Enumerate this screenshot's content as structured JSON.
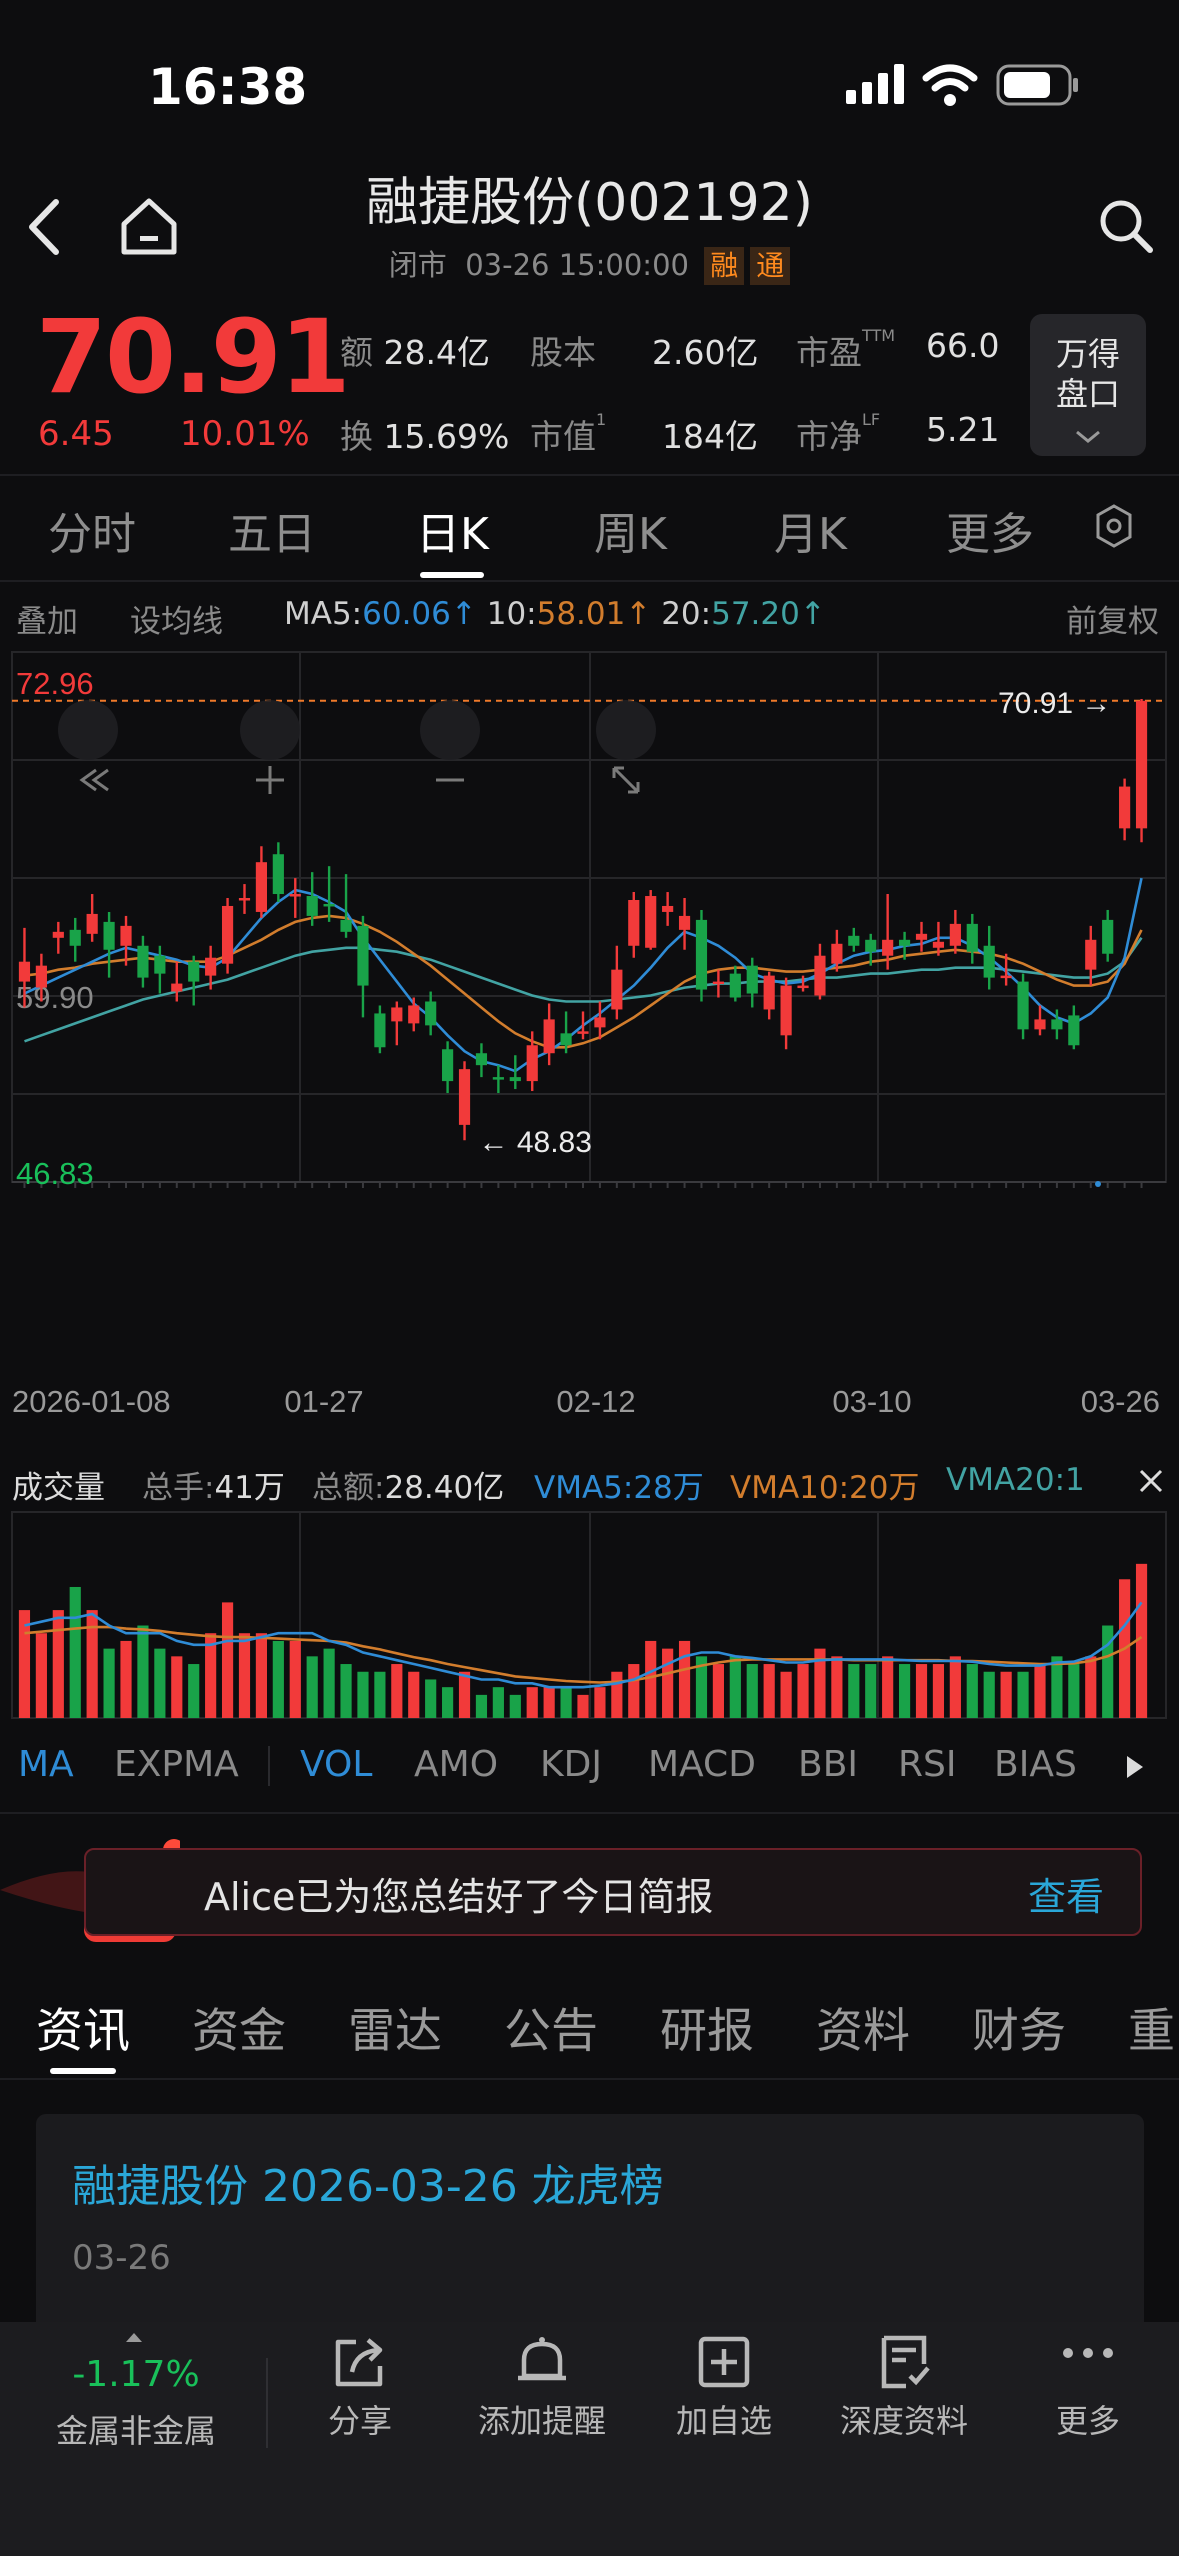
{
  "status": {
    "time": "16:38"
  },
  "header": {
    "title": "融捷股份(002192)",
    "status": "闭市",
    "datetime": "03-26 15:00:00",
    "tag1": "融",
    "tag2": "通"
  },
  "quote": {
    "price": "70.91",
    "change": "6.45",
    "change_pct": "10.01%",
    "amount_label": "额",
    "amount": "28.4亿",
    "capital_label": "股本",
    "capital": "2.60亿",
    "pe_label": "市盈",
    "pe_sup": "TTM",
    "pe": "66.0",
    "turnover_label": "换",
    "turnover": "15.69%",
    "mktcap_label": "市值",
    "mktcap_sup": "1",
    "mktcap": "184亿",
    "pb_label": "市净",
    "pb_sup": "LF",
    "pb": "5.21",
    "wande_line1": "万得",
    "wande_line2": "盘口"
  },
  "period_tabs": [
    "分时",
    "五日",
    "日K",
    "周K",
    "月K",
    "更多"
  ],
  "ma_bar": {
    "overlay": "叠加",
    "set_ma": "设均线",
    "ma5_label": "MA5:",
    "ma5": "60.06↑",
    "ma10_label": "10:",
    "ma10": "58.01↑",
    "ma20_label": "20:",
    "ma20": "57.20↑",
    "adjust": "前复权"
  },
  "chart_data": {
    "type": "candlestick",
    "y_labels": {
      "top": "72.96",
      "mid": "59.90",
      "bottom": "46.83"
    },
    "ylim": [
      46.83,
      72.96
    ],
    "x_labels": [
      "2026-01-08",
      "01-27",
      "02-12",
      "03-10",
      "03-26"
    ],
    "last_price_label": "70.91",
    "low_label": "48.83",
    "candles": [
      {
        "o": 56.8,
        "c": 57.8,
        "h": 59.5,
        "l": 55.5
      },
      {
        "o": 56.5,
        "c": 57.6,
        "h": 58.2,
        "l": 55.8
      },
      {
        "o": 59.0,
        "c": 59.3,
        "h": 59.8,
        "l": 58.2
      },
      {
        "o": 59.4,
        "c": 58.6,
        "h": 60.0,
        "l": 57.8
      },
      {
        "o": 59.2,
        "c": 60.2,
        "h": 61.2,
        "l": 58.8
      },
      {
        "o": 59.8,
        "c": 58.4,
        "h": 60.3,
        "l": 57.0
      },
      {
        "o": 58.6,
        "c": 59.6,
        "h": 60.1,
        "l": 57.6
      },
      {
        "o": 58.6,
        "c": 57.0,
        "h": 59.1,
        "l": 56.5
      },
      {
        "o": 58.1,
        "c": 57.2,
        "h": 58.6,
        "l": 56.2
      },
      {
        "o": 56.3,
        "c": 56.7,
        "h": 57.8,
        "l": 55.8
      },
      {
        "o": 57.8,
        "c": 56.8,
        "h": 58.1,
        "l": 55.6
      },
      {
        "o": 57.1,
        "c": 58.0,
        "h": 58.6,
        "l": 56.4
      },
      {
        "o": 57.7,
        "c": 60.6,
        "h": 61.0,
        "l": 57.2
      },
      {
        "o": 61.0,
        "c": 61.0,
        "h": 61.7,
        "l": 60.2
      },
      {
        "o": 60.3,
        "c": 62.8,
        "h": 63.6,
        "l": 60.0
      },
      {
        "o": 63.2,
        "c": 61.2,
        "h": 63.8,
        "l": 60.8
      },
      {
        "o": 61.1,
        "c": 61.2,
        "h": 62.0,
        "l": 60.0
      },
      {
        "o": 61.1,
        "c": 60.1,
        "h": 62.3,
        "l": 59.6
      },
      {
        "o": 60.7,
        "c": 60.6,
        "h": 62.6,
        "l": 59.8
      },
      {
        "o": 59.9,
        "c": 59.3,
        "h": 62.2,
        "l": 59.0
      },
      {
        "o": 59.6,
        "c": 56.6,
        "h": 60.1,
        "l": 55.0
      },
      {
        "o": 55.2,
        "c": 53.5,
        "h": 55.6,
        "l": 53.2
      },
      {
        "o": 54.8,
        "c": 55.5,
        "h": 55.8,
        "l": 53.6
      },
      {
        "o": 54.7,
        "c": 55.6,
        "h": 56.0,
        "l": 54.3
      },
      {
        "o": 55.8,
        "c": 54.6,
        "h": 56.3,
        "l": 54.1
      },
      {
        "o": 53.4,
        "c": 51.8,
        "h": 53.8,
        "l": 51.2
      },
      {
        "o": 49.6,
        "c": 52.4,
        "h": 52.8,
        "l": 48.83
      },
      {
        "o": 53.2,
        "c": 52.6,
        "h": 53.7,
        "l": 52.0
      },
      {
        "o": 52.0,
        "c": 51.9,
        "h": 52.6,
        "l": 51.2
      },
      {
        "o": 52.0,
        "c": 51.8,
        "h": 53.1,
        "l": 51.4
      },
      {
        "o": 51.8,
        "c": 53.6,
        "h": 54.3,
        "l": 51.3
      },
      {
        "o": 53.2,
        "c": 54.9,
        "h": 55.7,
        "l": 52.6
      },
      {
        "o": 54.2,
        "c": 53.6,
        "h": 55.3,
        "l": 53.2
      },
      {
        "o": 54.2,
        "c": 54.3,
        "h": 55.3,
        "l": 53.9
      },
      {
        "o": 54.5,
        "c": 55.0,
        "h": 55.8,
        "l": 53.9
      },
      {
        "o": 55.4,
        "c": 57.4,
        "h": 58.6,
        "l": 54.9
      },
      {
        "o": 58.6,
        "c": 60.9,
        "h": 61.3,
        "l": 58.0
      },
      {
        "o": 58.5,
        "c": 61.1,
        "h": 61.4,
        "l": 58.4
      },
      {
        "o": 60.3,
        "c": 60.6,
        "h": 61.3,
        "l": 59.6
      },
      {
        "o": 59.4,
        "c": 60.1,
        "h": 61.0,
        "l": 58.4
      },
      {
        "o": 59.9,
        "c": 56.4,
        "h": 60.4,
        "l": 55.8
      },
      {
        "o": 56.8,
        "c": 56.8,
        "h": 57.4,
        "l": 56.0
      },
      {
        "o": 57.2,
        "c": 56.0,
        "h": 57.6,
        "l": 55.8
      },
      {
        "o": 57.6,
        "c": 56.2,
        "h": 58.0,
        "l": 55.5
      },
      {
        "o": 55.4,
        "c": 57.1,
        "h": 57.3,
        "l": 54.9
      },
      {
        "o": 54.1,
        "c": 56.6,
        "h": 57.0,
        "l": 53.4
      },
      {
        "o": 56.6,
        "c": 56.6,
        "h": 57.1,
        "l": 56.3
      },
      {
        "o": 56.1,
        "c": 58.1,
        "h": 58.7,
        "l": 55.9
      },
      {
        "o": 57.7,
        "c": 58.7,
        "h": 59.4,
        "l": 57.3
      },
      {
        "o": 59.1,
        "c": 58.6,
        "h": 59.5,
        "l": 58.3
      },
      {
        "o": 58.9,
        "c": 58.3,
        "h": 59.2,
        "l": 57.6
      },
      {
        "o": 58.1,
        "c": 58.9,
        "h": 61.2,
        "l": 57.4
      },
      {
        "o": 58.9,
        "c": 58.6,
        "h": 59.3,
        "l": 57.9
      },
      {
        "o": 58.9,
        "c": 59.2,
        "h": 59.8,
        "l": 58.3
      },
      {
        "o": 58.5,
        "c": 58.8,
        "h": 59.8,
        "l": 58.1
      },
      {
        "o": 58.6,
        "c": 59.7,
        "h": 60.4,
        "l": 58.2
      },
      {
        "o": 59.7,
        "c": 58.3,
        "h": 60.2,
        "l": 57.7
      },
      {
        "o": 58.6,
        "c": 57.0,
        "h": 59.6,
        "l": 56.4
      },
      {
        "o": 57.0,
        "c": 57.1,
        "h": 58.2,
        "l": 56.6
      },
      {
        "o": 56.8,
        "c": 54.4,
        "h": 57.2,
        "l": 53.9
      },
      {
        "o": 54.4,
        "c": 54.9,
        "h": 55.6,
        "l": 54.1
      },
      {
        "o": 54.9,
        "c": 54.4,
        "h": 55.4,
        "l": 53.9
      },
      {
        "o": 55.1,
        "c": 53.6,
        "h": 55.6,
        "l": 53.4
      },
      {
        "o": 57.4,
        "c": 58.9,
        "h": 59.6,
        "l": 56.6
      },
      {
        "o": 59.9,
        "c": 58.2,
        "h": 60.4,
        "l": 57.8
      },
      {
        "o": 64.5,
        "c": 66.6,
        "h": 67.0,
        "l": 63.9
      },
      {
        "o": 64.5,
        "c": 70.91,
        "h": 71.0,
        "l": 63.8
      }
    ],
    "ma5": [
      56.2,
      56.6,
      57.0,
      57.4,
      57.8,
      58.2,
      58.5,
      58.3,
      58.1,
      57.9,
      57.6,
      57.5,
      58.0,
      59.0,
      60.0,
      60.8,
      61.4,
      61.2,
      60.8,
      60.3,
      59.0,
      57.9,
      56.8,
      55.7,
      55.0,
      54.1,
      53.3,
      52.8,
      52.6,
      52.3,
      52.9,
      53.3,
      53.9,
      54.6,
      55.2,
      55.9,
      56.6,
      57.5,
      58.5,
      59.3,
      59.0,
      58.6,
      58.0,
      57.2,
      56.9,
      56.7,
      56.8,
      57.2,
      57.7,
      58.1,
      58.3,
      58.4,
      58.6,
      58.7,
      59.0,
      59.0,
      58.6,
      58.0,
      57.3,
      56.5,
      55.6,
      55.0,
      54.7,
      55.2,
      56.0,
      58.0,
      62.0
    ],
    "ma10": [
      57.1,
      57.2,
      57.4,
      57.5,
      57.7,
      57.8,
      57.9,
      58.0,
      57.9,
      57.8,
      57.8,
      57.8,
      58.1,
      58.5,
      58.9,
      59.4,
      59.8,
      60.0,
      60.1,
      60.0,
      59.7,
      59.3,
      58.8,
      58.2,
      57.6,
      56.9,
      56.2,
      55.5,
      54.8,
      54.2,
      53.8,
      53.5,
      53.5,
      53.7,
      54.0,
      54.5,
      55.0,
      55.6,
      56.2,
      56.8,
      57.2,
      57.4,
      57.5,
      57.5,
      57.4,
      57.3,
      57.3,
      57.4,
      57.5,
      57.6,
      57.8,
      57.9,
      58.1,
      58.2,
      58.3,
      58.4,
      58.3,
      58.2,
      58.0,
      57.7,
      57.3,
      56.9,
      56.6,
      56.6,
      56.8,
      57.7,
      59.4
    ],
    "ma20": [
      53.8,
      54.1,
      54.4,
      54.7,
      55.0,
      55.3,
      55.6,
      55.9,
      56.1,
      56.3,
      56.5,
      56.7,
      56.9,
      57.2,
      57.5,
      57.8,
      58.1,
      58.3,
      58.4,
      58.5,
      58.5,
      58.4,
      58.3,
      58.1,
      57.9,
      57.6,
      57.3,
      57.0,
      56.7,
      56.4,
      56.1,
      55.9,
      55.8,
      55.8,
      55.8,
      55.9,
      56.0,
      56.1,
      56.3,
      56.5,
      56.6,
      56.7,
      56.7,
      56.8,
      56.8,
      56.8,
      56.9,
      57.0,
      57.0,
      57.1,
      57.2,
      57.2,
      57.3,
      57.4,
      57.4,
      57.5,
      57.5,
      57.5,
      57.4,
      57.3,
      57.2,
      57.1,
      57.0,
      57.0,
      57.2,
      57.8,
      59.0
    ],
    "colors": {
      "up": "#f23a3a",
      "down": "#19a349",
      "ma5": "#2f8cd6",
      "ma10": "#d27d2d",
      "ma20": "#42a3a3"
    }
  },
  "volume": {
    "title": "成交量",
    "total_hands_label": "总手:",
    "total_hands": "41万",
    "total_amount_label": "总额:",
    "total_amount": "28.40亿",
    "vma5": "VMA5:28万",
    "vma10": "VMA10:20万",
    "vma20": "VMA20:1",
    "bars": [
      14,
      11,
      14,
      17,
      14,
      9,
      10,
      12,
      9,
      8,
      7,
      11,
      15,
      11,
      11,
      10,
      10,
      8,
      9,
      7,
      6,
      6,
      7,
      6,
      5,
      4,
      6,
      3,
      4,
      3,
      4,
      4,
      4,
      3,
      4,
      6,
      7,
      10,
      9,
      10,
      8,
      7,
      8,
      7,
      7,
      6,
      7,
      9,
      8,
      7,
      7,
      8,
      7,
      7,
      7,
      8,
      7,
      6,
      6,
      6,
      7,
      8,
      7,
      8,
      12,
      18,
      20
    ],
    "ma5": [
      12,
      12.5,
      13,
      13,
      13.5,
      12,
      11,
      11,
      11,
      10,
      9.5,
      9.5,
      10,
      10,
      10.5,
      11,
      11,
      11,
      10,
      9.5,
      8.5,
      8,
      7.5,
      7,
      6.5,
      6,
      5.5,
      5,
      5,
      4.5,
      4.5,
      4,
      4,
      4,
      4.2,
      4.5,
      5,
      6,
      7,
      8,
      8.5,
      8.5,
      8,
      7.8,
      7.5,
      7.2,
      7.2,
      7.5,
      7.6,
      7.6,
      7.6,
      7.6,
      7.5,
      7.4,
      7.4,
      7.4,
      7.3,
      7,
      6.8,
      6.8,
      6.8,
      7.2,
      7.3,
      8,
      9.5,
      12,
      15
    ],
    "ma10": [
      11,
      11.2,
      11.4,
      11.6,
      11.8,
      11.8,
      11.6,
      11.5,
      11.3,
      11,
      10.8,
      10.6,
      10.5,
      10.5,
      10.4,
      10.3,
      10.2,
      10.1,
      10,
      9.8,
      9.3,
      8.9,
      8.4,
      7.9,
      7.5,
      7,
      6.6,
      6.2,
      5.8,
      5.4,
      5.2,
      5,
      4.8,
      4.7,
      4.6,
      4.7,
      4.9,
      5.3,
      5.8,
      6.3,
      6.8,
      7.2,
      7.5,
      7.6,
      7.6,
      7.6,
      7.6,
      7.6,
      7.6,
      7.5,
      7.5,
      7.5,
      7.5,
      7.5,
      7.5,
      7.4,
      7.4,
      7.3,
      7.2,
      7.1,
      7,
      7,
      7.1,
      7.4,
      8,
      9,
      10.5
    ],
    "colors": {
      "ma5": "#2f8cd6",
      "ma10": "#d27d2d",
      "ma20": "#42a3a3"
    }
  },
  "indicators": [
    "MA",
    "EXPMA",
    "VOL",
    "AMO",
    "KDJ",
    "MACD",
    "BBI",
    "RSI",
    "BIAS"
  ],
  "banner": {
    "text": "Alice已为您总结好了今日简报",
    "action": "查看"
  },
  "news_tabs": [
    "资讯",
    "资金",
    "雷达",
    "公告",
    "研报",
    "资料",
    "财务",
    "重"
  ],
  "news": {
    "title": "融捷股份 2026-03-26 龙虎榜",
    "date": "03-26"
  },
  "bottom": {
    "sector_change": "-1.17%",
    "sector_name": "金属非金属",
    "share": "分享",
    "alert": "添加提醒",
    "watchlist": "加自选",
    "deep": "深度资料",
    "more": "更多"
  }
}
